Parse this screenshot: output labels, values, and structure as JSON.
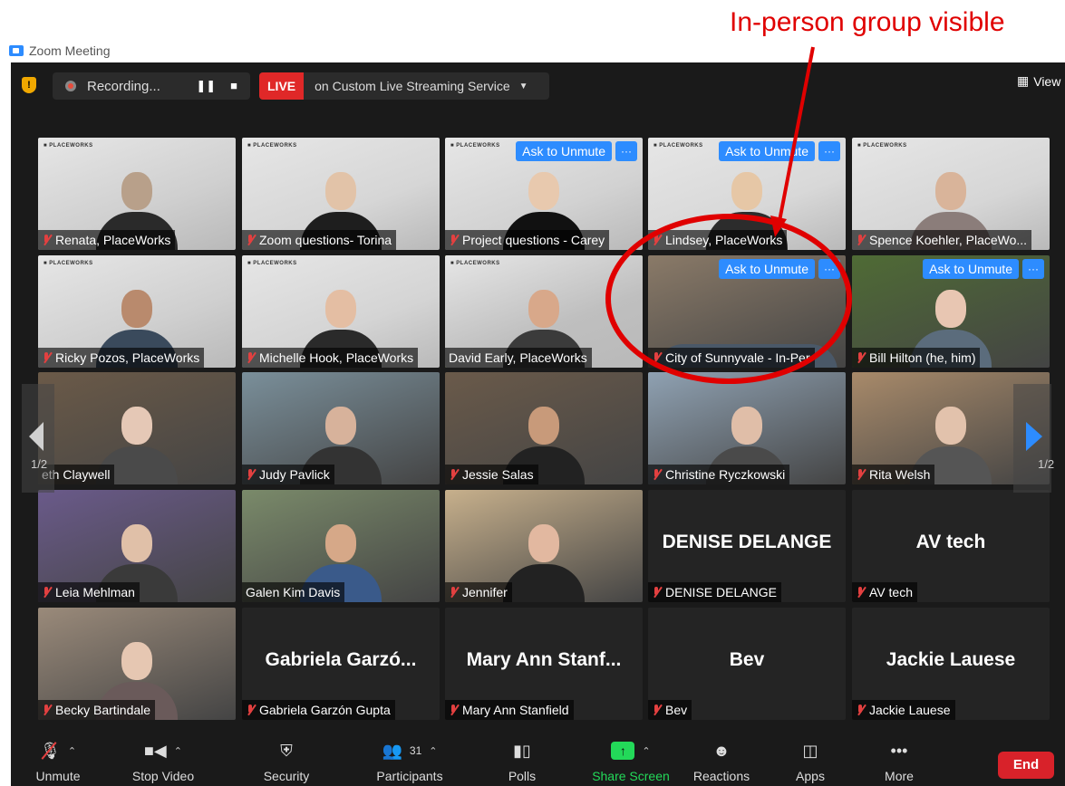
{
  "annotation": {
    "text": "In-person group visible",
    "color": "#e00000"
  },
  "window": {
    "title": "Zoom Meeting"
  },
  "topbar": {
    "recording_label": "Recording...",
    "pause_icon": "pause-icon",
    "stop_icon": "stop-icon",
    "live_tag": "LIVE",
    "stream_label": "on Custom Live Streaming Service",
    "view_label": "View"
  },
  "pagination": {
    "left": "1/2",
    "right": "1/2"
  },
  "tiles": [
    {
      "name": "Renata, PlaceWorks",
      "muted": true,
      "ask": false
    },
    {
      "name": "Zoom questions- Torina",
      "muted": true,
      "ask": false
    },
    {
      "name": "Project questions - Carey",
      "muted": true,
      "ask": true
    },
    {
      "name": "Lindsey, PlaceWorks",
      "muted": true,
      "ask": true
    },
    {
      "name": "Spence Koehler, PlaceWo...",
      "muted": true,
      "ask": false
    },
    {
      "name": "Ricky Pozos, PlaceWorks",
      "muted": true,
      "ask": false
    },
    {
      "name": "Michelle Hook, PlaceWorks",
      "muted": true,
      "ask": false
    },
    {
      "name": "David Early, PlaceWorks",
      "muted": false,
      "ask": false,
      "active": true
    },
    {
      "name": "City of Sunnyvale - In-Per",
      "muted": true,
      "ask": true
    },
    {
      "name": "Bill Hilton (he, him)",
      "muted": true,
      "ask": true
    },
    {
      "name": "eth Claywell",
      "muted": false,
      "ask": false
    },
    {
      "name": "Judy Pavlick",
      "muted": true,
      "ask": false
    },
    {
      "name": "Jessie Salas",
      "muted": true,
      "ask": false
    },
    {
      "name": "Christine Ryczkowski",
      "muted": true,
      "ask": false
    },
    {
      "name": "Rita Welsh",
      "muted": true,
      "ask": false
    },
    {
      "name": "Leia Mehlman",
      "muted": true,
      "ask": false
    },
    {
      "name": "Galen Kim Davis",
      "muted": false,
      "ask": false
    },
    {
      "name": "Jennifer",
      "muted": true,
      "ask": false
    },
    {
      "name": "DENISE DELANGE",
      "muted": true,
      "ask": false,
      "big": "DENISE DELANGE"
    },
    {
      "name": "AV tech",
      "muted": true,
      "ask": false,
      "big": "AV tech"
    },
    {
      "name": "Becky Bartindale",
      "muted": true,
      "ask": false
    },
    {
      "name": "Gabriela Garzón Gupta",
      "muted": true,
      "ask": false,
      "big": "Gabriela  Garzó..."
    },
    {
      "name": "Mary Ann Stanfield",
      "muted": true,
      "ask": false,
      "big": "Mary  Ann  Stanf..."
    },
    {
      "name": "Bev",
      "muted": true,
      "ask": false,
      "big": "Bev"
    },
    {
      "name": "Jackie Lauese",
      "muted": true,
      "ask": false,
      "big": "Jackie Lauese"
    }
  ],
  "ask_label": "Ask to Unmute",
  "more_label": "···",
  "toolbar": {
    "unmute": "Unmute",
    "stop_video": "Stop Video",
    "security": "Security",
    "participants": "Participants",
    "participants_count": "31",
    "polls": "Polls",
    "share_screen": "Share Screen",
    "reactions": "Reactions",
    "apps": "Apps",
    "more": "More",
    "end": "End"
  },
  "colors": {
    "accent": "#2d8cff",
    "end": "#d8222a",
    "share": "#23d959",
    "live": "#e02828"
  }
}
